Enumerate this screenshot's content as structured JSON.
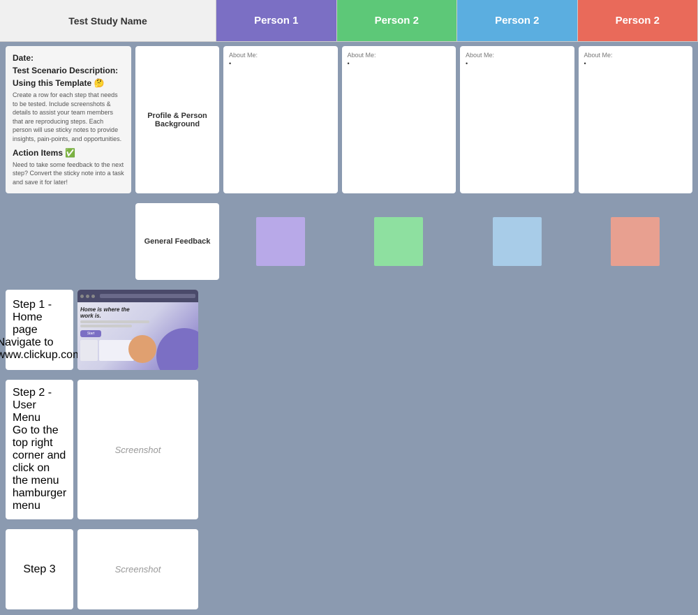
{
  "header": {
    "title": "Test Study Name",
    "persons": [
      "Person 1",
      "Person 2",
      "Person 2",
      "Person 2"
    ]
  },
  "infoPanel": {
    "date_label": "Date:",
    "scenario_label": "Test Scenario Description:",
    "template_label": "Using this Template 🤔",
    "template_text": "Create a row for each step that needs to be tested. Include screenshots & details to assist your team members that are reproducing steps. Each person will use sticky notes to provide insights, pain-points, and opportunities.",
    "action_label": "Action Items ✅",
    "action_text": "Need to take some feedback to the next step? Convert the sticky note into a task and save it for later!"
  },
  "profileSection": {
    "label": "Profile & Person\nBackground",
    "about_label": "About Me:",
    "about_dot": "•"
  },
  "generalFeedback": {
    "label": "General Feedback"
  },
  "steps": [
    {
      "title": "Step 1 - Home page",
      "nav_prefix": "Navigate to ",
      "nav_link": "www.clickup.com",
      "screenshot_placeholder": null,
      "has_image": true
    },
    {
      "title": "Step 2 - User Menu",
      "nav_text": "Go to the top right corner and click on the menu hamburger menu",
      "screenshot_label": "Screenshot",
      "has_image": false
    },
    {
      "title": "Step 3",
      "nav_text": "",
      "screenshot_label": "Screenshot",
      "has_image": false
    }
  ],
  "colors": {
    "person1": "#7b6fc4",
    "person2a": "#5dc878",
    "person2b": "#5baee0",
    "person2c": "#e96a5a",
    "sticky_purple": "#b8a9e8",
    "sticky_green": "#8ee0a0",
    "sticky_blue": "#a8cce8",
    "sticky_salmon": "#e8a090"
  }
}
